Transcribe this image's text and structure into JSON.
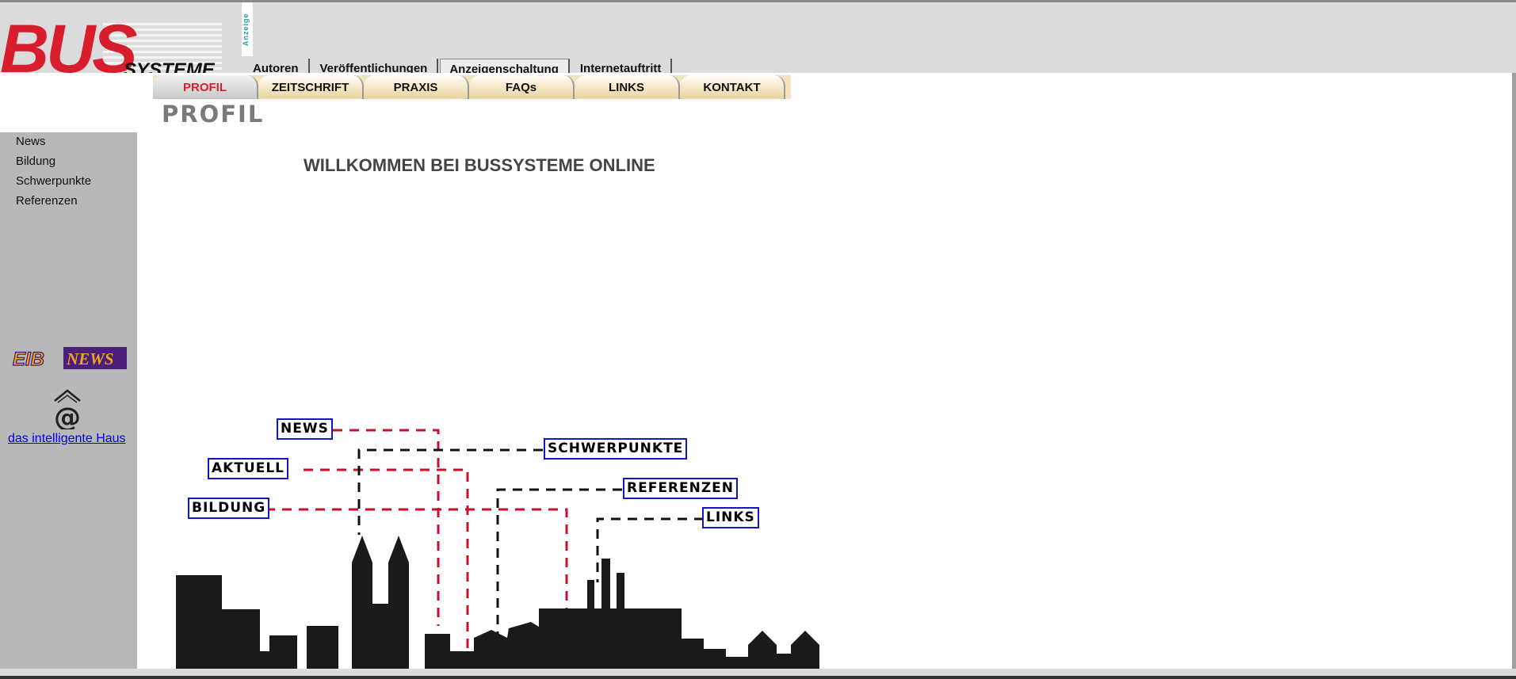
{
  "header": {
    "logo_main": "BUS",
    "logo_sub": "SYSTEME",
    "ad_label": "Anzeige",
    "top_tabs": [
      {
        "label": "Autoren"
      },
      {
        "label": "Veröffentlichungen"
      },
      {
        "label": "Anzeigenschaltung"
      },
      {
        "label": "Internetauftritt"
      }
    ]
  },
  "nav": {
    "tabs": [
      {
        "label": "PROFIL"
      },
      {
        "label": "ZEITSCHRIFT"
      },
      {
        "label": "PRAXIS"
      },
      {
        "label": "FAQs"
      },
      {
        "label": "LINKS"
      },
      {
        "label": "KONTAKT"
      }
    ],
    "active": "PROFIL"
  },
  "section_title": "PROFIL",
  "sidebar": {
    "links": [
      {
        "label": "News"
      },
      {
        "label": "Bildung"
      },
      {
        "label": "Schwerpunkte"
      },
      {
        "label": "Referenzen"
      }
    ],
    "eib_logo_left": "EIB",
    "eib_logo_right": "NEWS",
    "home_link": "das intelligente Haus"
  },
  "main": {
    "welcome": "WILLKOMMEN BEI BUSSYSTEME ONLINE",
    "skyline_labels": [
      {
        "label": "NEWS"
      },
      {
        "label": "SCHWERPUNKTE"
      },
      {
        "label": "AKTUELL"
      },
      {
        "label": "REFERENZEN"
      },
      {
        "label": "BILDUNG"
      },
      {
        "label": "LINKS"
      }
    ]
  },
  "colors": {
    "brand_red": "#d81e2c",
    "link_blue": "#0000ee",
    "label_border": "#1414c8",
    "sidebar_grey": "#b8b8b8"
  }
}
